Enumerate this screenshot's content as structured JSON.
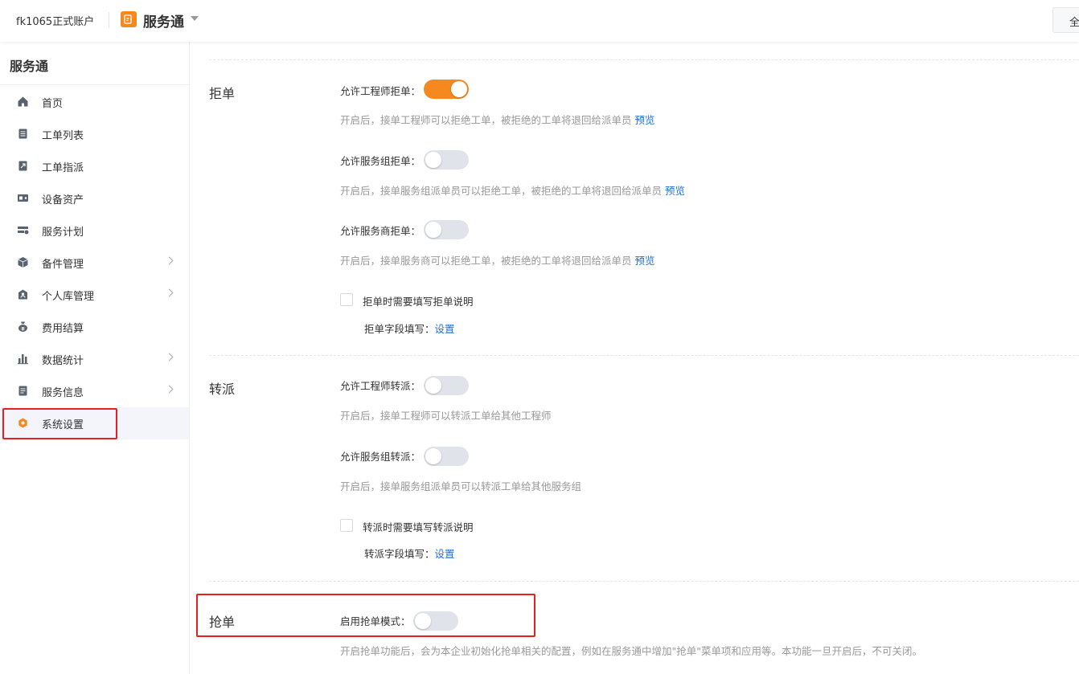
{
  "topbar": {
    "account": "fk1065正式账户",
    "app_name": "服务通",
    "right_button": "全"
  },
  "sidebar": {
    "title": "服务通",
    "items": [
      {
        "label": "首页",
        "icon": "home-icon",
        "has_arrow": false
      },
      {
        "label": "工单列表",
        "icon": "list-icon",
        "has_arrow": false
      },
      {
        "label": "工单指派",
        "icon": "assign-icon",
        "has_arrow": false
      },
      {
        "label": "设备资产",
        "icon": "device-icon",
        "has_arrow": false
      },
      {
        "label": "服务计划",
        "icon": "plan-icon",
        "has_arrow": false
      },
      {
        "label": "备件管理",
        "icon": "parts-icon",
        "has_arrow": true
      },
      {
        "label": "个人库管理",
        "icon": "personal-stock-icon",
        "has_arrow": true
      },
      {
        "label": "费用结算",
        "icon": "money-bag-icon",
        "has_arrow": false
      },
      {
        "label": "数据统计",
        "icon": "bar-chart-icon",
        "has_arrow": true
      },
      {
        "label": "服务信息",
        "icon": "info-icon",
        "has_arrow": true
      },
      {
        "label": "系统设置",
        "icon": "gear-icon",
        "has_arrow": false,
        "active": true
      }
    ]
  },
  "reject": {
    "title": "拒单",
    "engineer_label": "允许工程师拒单：",
    "engineer_on": true,
    "engineer_desc": "开启后，接单工程师可以拒绝工单，被拒绝的工单将退回给派单员",
    "group_label": "允许服务组拒单：",
    "group_on": false,
    "group_desc": "开启后，接单服务组派单员可以拒绝工单，被拒绝的工单将退回给派单员",
    "provider_label": "允许服务商拒单：",
    "provider_on": false,
    "provider_desc": "开启后，接单服务商可以拒绝工单，被拒绝的工单将退回给派单员",
    "preview_link": "预览",
    "require_note": "拒单时需要填写拒单说明",
    "field_label": "拒单字段填写：",
    "field_link": "设置"
  },
  "transfer": {
    "title": "转派",
    "engineer_label": "允许工程师转派：",
    "engineer_on": false,
    "engineer_desc": "开启后，接单工程师可以转派工单给其他工程师",
    "group_label": "允许服务组转派：",
    "group_on": false,
    "group_desc": "开启后，接单服务组派单员可以转派工单给其他服务组",
    "require_note": "转派时需要填写转派说明",
    "field_label": "转派字段填写：",
    "field_link": "设置"
  },
  "grab": {
    "title": "抢单",
    "mode_label": "启用抢单模式：",
    "mode_on": false,
    "desc": "开启抢单功能后，会为本企业初始化抢单相关的配置，例如在服务通中增加\"抢单\"菜单项和应用等。本功能一旦开启后，不可关闭。"
  },
  "colors": {
    "accent": "#f5891f",
    "link": "#1e6fd9",
    "highlight": "#e5201f"
  }
}
